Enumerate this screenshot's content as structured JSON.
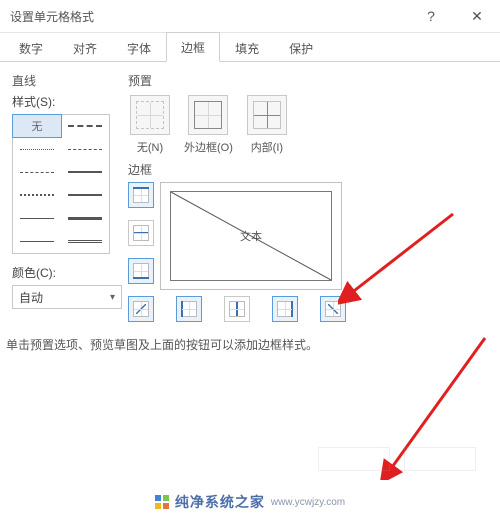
{
  "window": {
    "title": "设置单元格格式"
  },
  "tabs": {
    "items": [
      "数字",
      "对齐",
      "字体",
      "边框",
      "填充",
      "保护"
    ],
    "active_index": 3
  },
  "left": {
    "line_group_title": "直线",
    "style_label": "样式(S):",
    "none_text": "无",
    "color_label": "颜色(C):",
    "color_value": "自动"
  },
  "right": {
    "preset_title": "预置",
    "presets": {
      "none": "无(N)",
      "outline": "外边框(O)",
      "inside": "内部(I)"
    },
    "border_title": "边框",
    "preview_label": "文本"
  },
  "help_text": "单击预置选项、预览草图及上面的按钮可以添加边框样式。",
  "watermark": {
    "text": "纯净系统之家",
    "url": "www.ycwjzy.com"
  }
}
